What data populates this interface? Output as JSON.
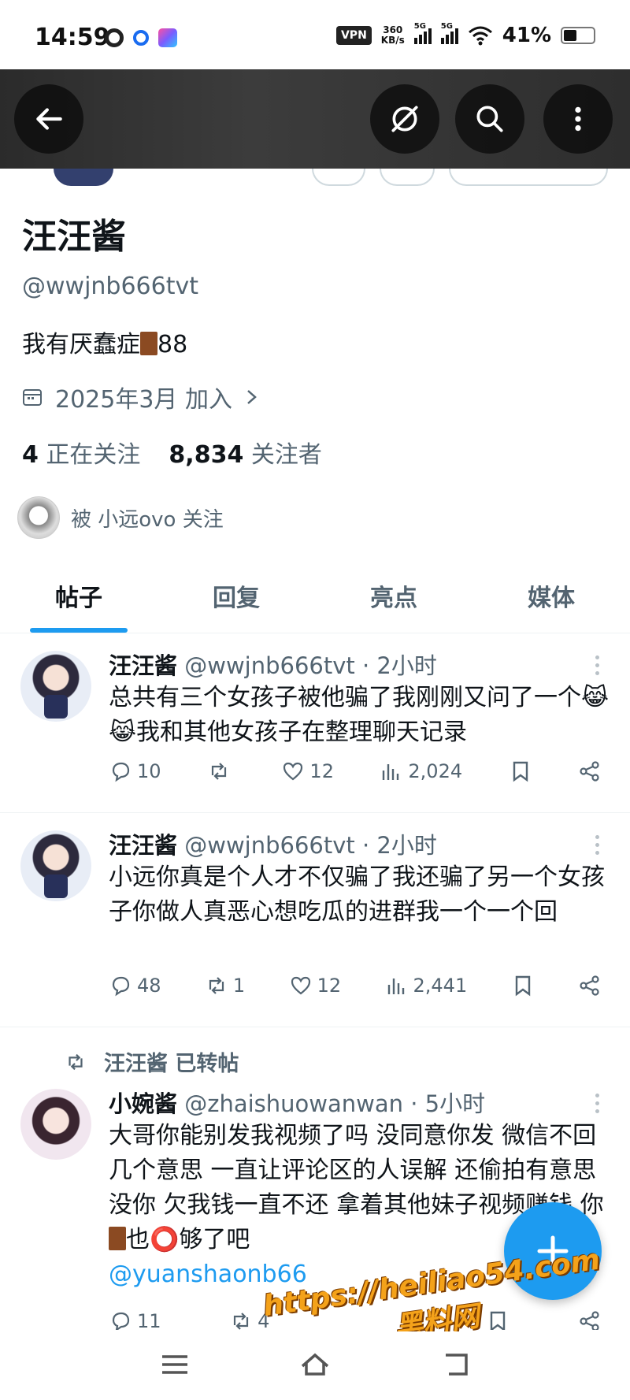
{
  "status_bar": {
    "time": "14:59",
    "vpn": "VPN",
    "speed_top": "360",
    "speed_bottom": "KB/s",
    "net1": "5G",
    "net2": "5G",
    "battery": "41%"
  },
  "profile": {
    "name": "汪汪酱",
    "handle": "@wwjnb666tvt",
    "bio_text": "我有厌蠢症",
    "bio_suffix": "88",
    "joined": "2025年3月 加入",
    "following_count": "4",
    "following_label": "正在关注",
    "followers_count": "8,834",
    "followers_label": "关注者",
    "followed_by": "被 小远ovo 关注"
  },
  "tabs": [
    {
      "label": "帖子",
      "active": true
    },
    {
      "label": "回复",
      "active": false
    },
    {
      "label": "亮点",
      "active": false
    },
    {
      "label": "媒体",
      "active": false
    }
  ],
  "posts": [
    {
      "display_name": "汪汪酱",
      "meta": "@wwjnb666tvt · 2小时",
      "text": "总共有三个女孩子被他骗了我刚刚又问了一个😹😹我和其他女孩子在整理聊天记录",
      "replies": "10",
      "reposts": "",
      "likes": "12",
      "views": "2,024"
    },
    {
      "display_name": "汪汪酱",
      "meta": "@wwjnb666tvt · 2小时",
      "text": "小远你真是个人才不仅骗了我还骗了另一个女孩子你做人真恶心想吃瓜的进群我一个一个回",
      "replies": "48",
      "reposts": "1",
      "likes": "12",
      "views": "2,441"
    },
    {
      "repost_label": "汪汪酱 已转帖",
      "display_name": "小婉酱",
      "meta": "@zhaishuowanwan · 5小时",
      "text_a": "大哥你能别发我视频了吗 没同意你发 微信不回几个意思 一直让评论区的人误解 还偷拍有意思没你 欠我钱一直不还 拿着其他妹子视频赚钱 你",
      "text_b": "也⭕够了吧",
      "mention": "@yuanshaonb66",
      "replies": "11",
      "reposts": "4"
    }
  ],
  "watermark": {
    "line1": "https://heiliao54.com",
    "line2": "黑料网"
  },
  "icons": [
    "back-arrow-icon",
    "grok-icon",
    "search-icon",
    "more-vertical-icon",
    "calendar-icon",
    "chevron-right-icon",
    "reply-icon",
    "repost-icon",
    "like-icon",
    "views-icon",
    "bookmark-icon",
    "share-icon",
    "plus-icon",
    "menu-icon",
    "home-icon",
    "back-nav-icon"
  ],
  "colors": {
    "accent": "#1d9bf0",
    "text": "#0f1419",
    "muted": "#536471"
  }
}
